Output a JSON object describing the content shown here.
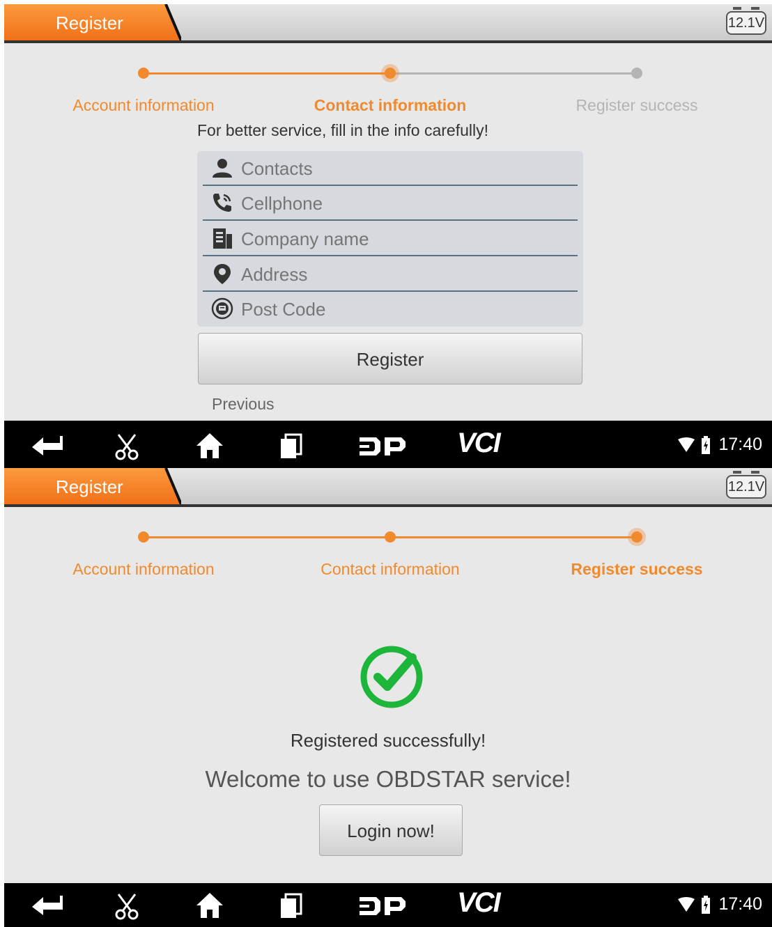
{
  "status": {
    "voltage": "12.1V",
    "time": "17:40"
  },
  "nav": {
    "dp_label": "DP",
    "vci_label": "VCI"
  },
  "screen1": {
    "tab_title": "Register",
    "steps": [
      {
        "label": "Account information",
        "state": "done"
      },
      {
        "label": "Contact information",
        "state": "current"
      },
      {
        "label": "Register success",
        "state": "pending"
      }
    ],
    "hint": "For better service, fill in the info carefully!",
    "fields": [
      {
        "placeholder": "Contacts",
        "icon": "person-icon"
      },
      {
        "placeholder": "Cellphone",
        "icon": "phone-icon"
      },
      {
        "placeholder": "Company name",
        "icon": "building-icon"
      },
      {
        "placeholder": "Address",
        "icon": "location-pin-icon"
      },
      {
        "placeholder": "Post Code",
        "icon": "post-code-icon"
      }
    ],
    "register_button": "Register",
    "previous_link": "Previous"
  },
  "screen2": {
    "tab_title": "Register",
    "steps": [
      {
        "label": "Account information",
        "state": "done"
      },
      {
        "label": "Contact information",
        "state": "done"
      },
      {
        "label": "Register success",
        "state": "current"
      }
    ],
    "message_1": "Registered successfully!",
    "message_2": "Welcome to use OBDSTAR service!",
    "login_button": "Login now!"
  },
  "colors": {
    "accent": "#f08a2c",
    "inactive": "#b4b4b4",
    "success": "#1db53a"
  }
}
